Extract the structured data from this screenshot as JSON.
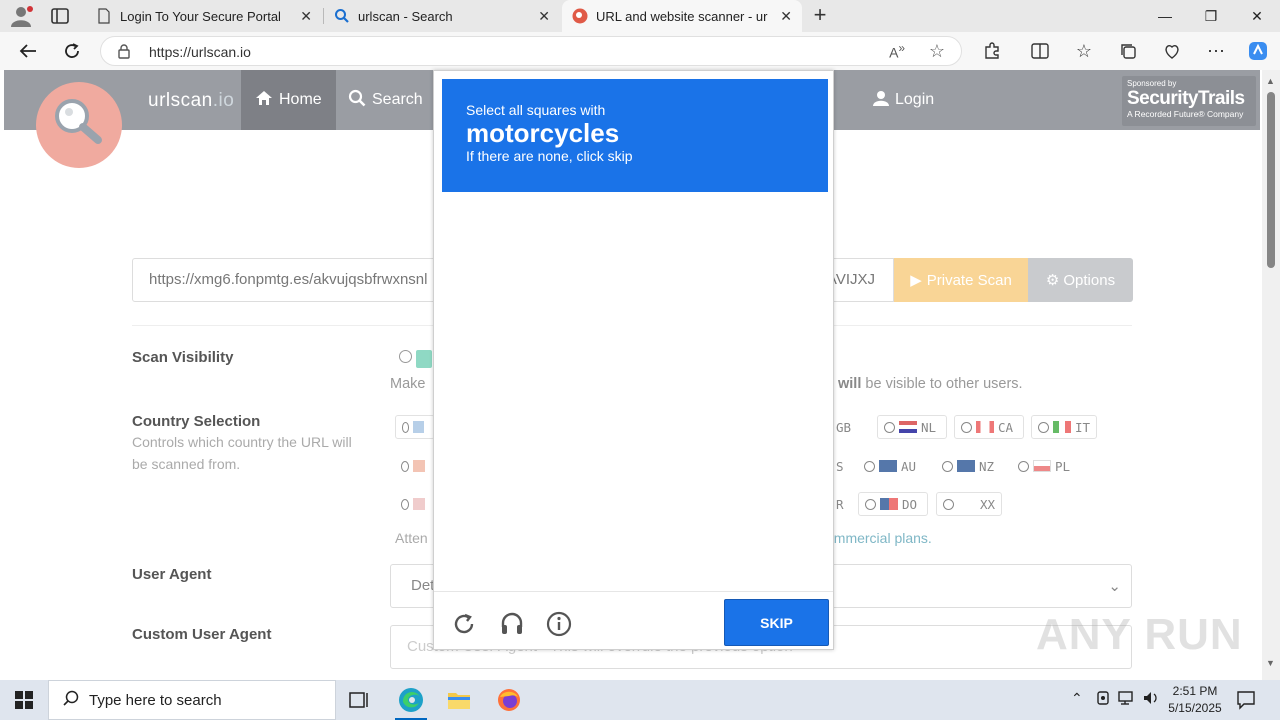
{
  "browser": {
    "tabs": [
      {
        "title": "Login To Your Secure Portal",
        "icon": "page-icon",
        "active": false
      },
      {
        "title": "urlscan - Search",
        "icon": "search-icon",
        "active": false
      },
      {
        "title": "URL and website scanner - urlsca",
        "icon": "urlscan-icon",
        "active": true
      }
    ],
    "url_host": "https://urlscan.io",
    "minimize": "—",
    "restore": "❐",
    "close": "✕"
  },
  "page": {
    "brand": "urlscan",
    "brand_suffix": ".io",
    "nav": {
      "home": "Home",
      "search": "Search",
      "partial": "g",
      "login": "Login"
    },
    "sponsor": {
      "line1": "Sponsored by",
      "line2": "SecurityTrails",
      "line3": "A Recorded Future® Company"
    },
    "scan_input_value": "https://xmg6.fonpmtg.es/akvujqsbfrwxnsnl",
    "scan_input_tail": "AVIJXJ",
    "private_scan": "Private Scan",
    "options": "Options",
    "scan_visibility": {
      "label": "Scan Visibility",
      "text_start": "Make",
      "text_end_bold": "will",
      "text_end": "be visible to other users."
    },
    "country": {
      "label": "Country Selection",
      "description": "Controls which country the URL will be scanned from.",
      "row1": [
        "GB",
        "NL",
        "CA",
        "IT"
      ],
      "row2": [
        "S",
        "AU",
        "NZ",
        "PL"
      ],
      "row3": [
        "R",
        "DO",
        "XX"
      ],
      "note_start": "Atten",
      "note_link": "ommercial plans."
    },
    "user_agent": {
      "label": "User Agent",
      "value": "Det"
    },
    "custom_user_agent": {
      "label": "Custom User Agent",
      "placeholder": "Custom User Agent - This will overrule the previous option"
    },
    "watermark": "ANY RUN"
  },
  "captcha": {
    "line1": "Select all squares with",
    "target": "motorcycles",
    "line3": "If there are none, click skip",
    "skip": "SKIP",
    "icons": [
      "reload-icon",
      "audio-icon",
      "info-icon"
    ]
  },
  "taskbar": {
    "search_placeholder": "Type here to search",
    "time": "2:51 PM",
    "date": "5/15/2025"
  }
}
